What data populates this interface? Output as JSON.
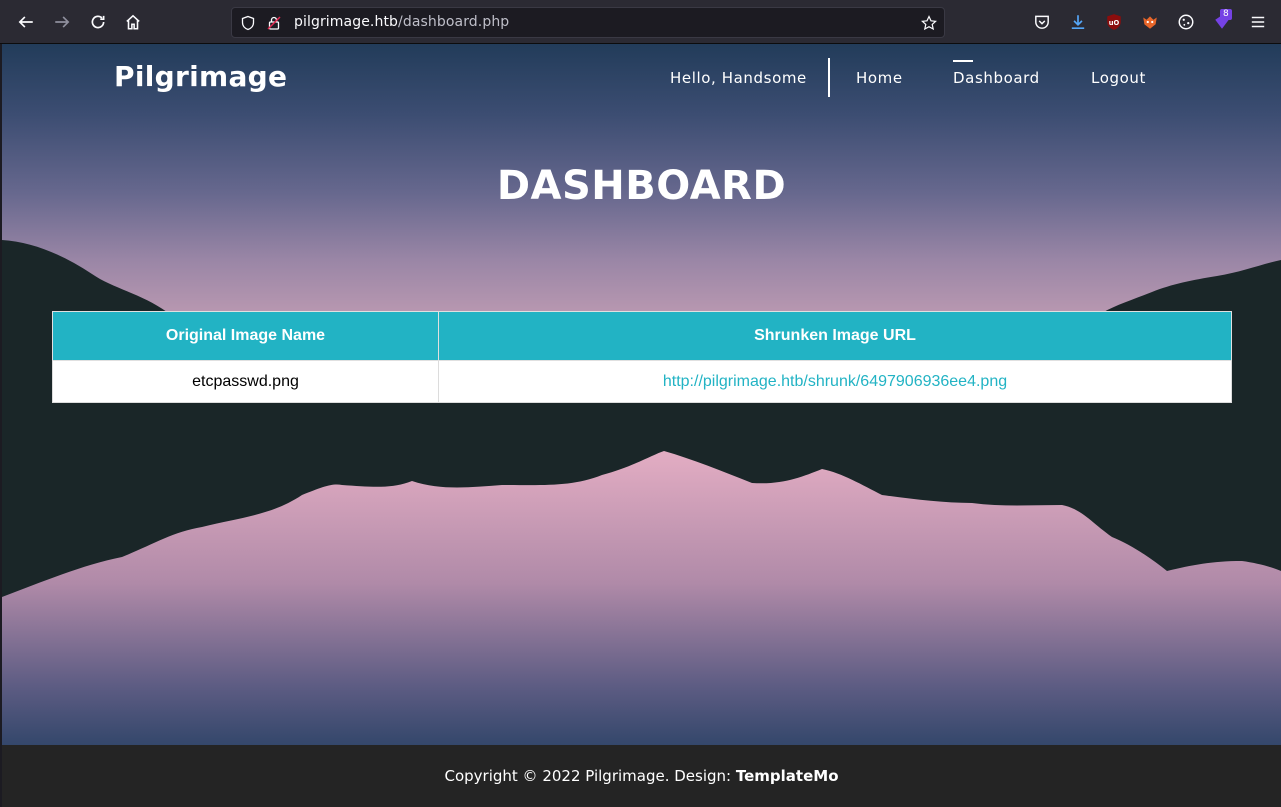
{
  "browser": {
    "url_host": "pilgrimage.htb",
    "url_path": "/dashboard.php",
    "extension_badge": "8"
  },
  "site": {
    "brand": "Pilgrimage",
    "nav": {
      "greeting": "Hello, Handsome",
      "home": "Home",
      "dashboard": "Dashboard",
      "logout": "Logout"
    },
    "page_title": "DASHBOARD"
  },
  "table": {
    "headers": [
      "Original Image Name",
      "Shrunken Image URL"
    ],
    "rows": [
      {
        "original": "etcpasswd.png",
        "url": "http://pilgrimage.htb/shrunk/6497906936ee4.png"
      }
    ]
  },
  "footer": {
    "text": "Copyright © 2022 Pilgrimage. Design: ",
    "link": "TemplateMo"
  },
  "colors": {
    "accent": "#22b3c4",
    "footer_bg": "#242424",
    "chrome_bg": "#2b2a33"
  }
}
